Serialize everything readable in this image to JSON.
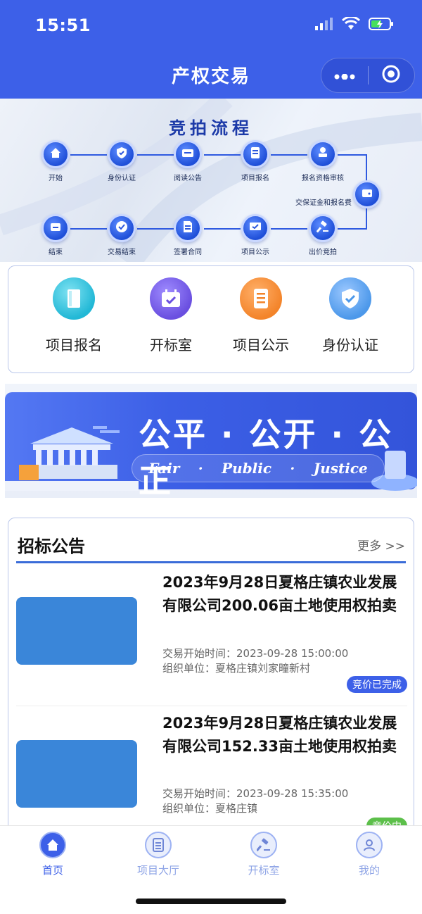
{
  "status_bar": {
    "time": "15:51"
  },
  "nav": {
    "title": "产权交易"
  },
  "process": {
    "title": "竞拍流程",
    "steps": [
      "开始",
      "身份认证",
      "阅读公告",
      "项目报名",
      "报名资格审核",
      "交保证金和报名费",
      "出价竞拍",
      "项目公示",
      "签署合同",
      "交易结束",
      "结束"
    ]
  },
  "quick_menu": [
    {
      "label": "项目报名",
      "color": "#22b8d6"
    },
    {
      "label": "开标室",
      "color": "#6a4fe0"
    },
    {
      "label": "项目公示",
      "color": "#f3842a"
    },
    {
      "label": "身份认证",
      "color": "#4c98ea"
    }
  ],
  "slogan": {
    "cn": "公平 · 公开 · 公正",
    "en": [
      "Fair",
      "·",
      "Public",
      "·",
      "Justice"
    ]
  },
  "notice": {
    "title": "招标公告",
    "more": "更多 >>",
    "items": [
      {
        "title": "2023年9月28日夏格庄镇农业发展有限公司200.06亩土地使用权拍卖",
        "time": "交易开始时间：2023-09-28 15:00:00",
        "org": "组织单位：夏格庄镇刘家疃新村",
        "status": "竞价已完成",
        "status_color": "#3d60e8"
      },
      {
        "title": "2023年9月28日夏格庄镇农业发展有限公司152.33亩土地使用权拍卖",
        "time": "交易开始时间：2023-09-28 15:35:00",
        "org": "组织单位：夏格庄镇",
        "status": "竞价中",
        "status_color": "#5cbf4a"
      }
    ]
  },
  "tabbar": [
    {
      "label": "首页",
      "active": true
    },
    {
      "label": "项目大厅",
      "active": false
    },
    {
      "label": "开标室",
      "active": false
    },
    {
      "label": "我的",
      "active": false
    }
  ],
  "colors": {
    "primary": "#3d60e8",
    "tab_active": "#3d60e8",
    "tab_inactive": "#8ea4e6"
  }
}
